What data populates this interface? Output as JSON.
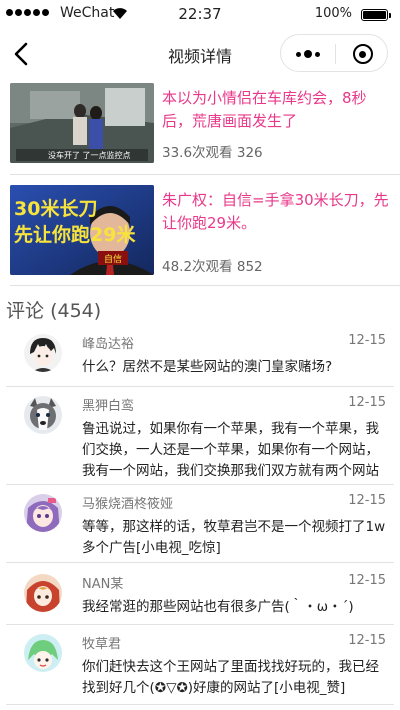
{
  "status_bar": {
    "carrier": "WeChat",
    "time": "22:37",
    "battery": "100%",
    "battery_level": 1.0
  },
  "nav": {
    "title": "视频详情",
    "back_icon": "chevron-left-icon",
    "more_icon": "more-dots-icon",
    "close_icon": "target-close-icon"
  },
  "videos": [
    {
      "title": "本以为小情侣在车库约会，8秒后，荒唐画面发生了",
      "views": "33.6次观看",
      "count": "326",
      "thumb_caption": "没车开了 了一点监控点"
    },
    {
      "title": "朱广权：自信=手拿30米长刀，先让你跑29米。",
      "views": "48.2次观看",
      "count": "852",
      "thumb_text_1": "30米长刀",
      "thumb_text_2": "先让你跑29米",
      "thumb_badge": "自信"
    }
  ],
  "comments_header": {
    "label": "评论",
    "count": "(454)"
  },
  "comments": [
    {
      "name": "峰岛达裕",
      "date": "12-15",
      "text": "什么？居然不是某些网站的澳门皇家赌场?"
    },
    {
      "name": "黑狎白鸾",
      "date": "12-15",
      "text": "鲁迅说过，如果你有一个苹果，我有一个苹果，我们交换，一人还是一个苹果，如果你有一个网站，我有一个网站，我们交换那我们双方就有两个网站"
    },
    {
      "name": "马猴烧酒柊筱娅",
      "date": "12-15",
      "text": "等等，那这样的话，牧草君岂不是一个视频打了1w多个广告[小电视_吃惊]"
    },
    {
      "name": "NAN某",
      "date": "12-15",
      "text": "我经常逛的那些网站也有很多广告(｀・ω・´)"
    },
    {
      "name": "牧草君",
      "date": "12-15",
      "text": "你们赶快去这个王网站了里面找找好玩的，我已经找到好几个(✪▽✪)好康的网站了[小电视_赞]"
    }
  ],
  "colors": {
    "accent_pink": "#e8388a",
    "meta_gray": "#666666",
    "divider": "#e2e2e2"
  }
}
